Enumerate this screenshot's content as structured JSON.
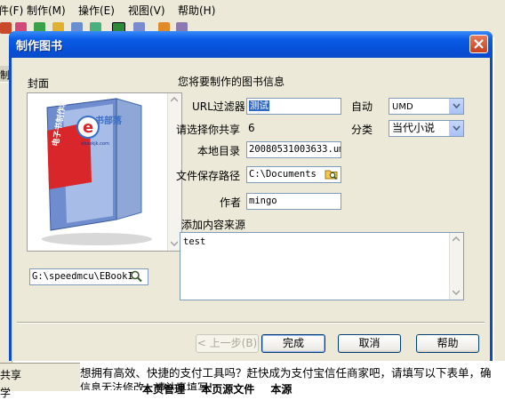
{
  "app": {
    "menu": [
      "件(F)",
      "制作(M)",
      "操作(E)",
      "视图(V)",
      "帮助(H)"
    ],
    "left_panel": {
      "label_top": "制",
      "label_share": "共享",
      "label_bottom": "学"
    },
    "notice_line1": "想拥有高效、快捷的支付工具吗？赶快成为支付宝信任商家吧，请填写以下表单，确",
    "notice_line2": "信息无法修改，请认真填写！",
    "bottom_tabs": [
      "本页管理",
      "本页源文件",
      "本源"
    ]
  },
  "dialog": {
    "title": "制作图书",
    "cover_label": "封面",
    "section_title": "您将要制作的图书信息",
    "cover_path": "G:\\speedmcu\\EBookI",
    "fields": {
      "url_filter_label": "URL过滤器",
      "url_filter_value": "测试",
      "auto_label": "自动",
      "auto_value": "UMD",
      "share_label": "请选择你共享",
      "share_value": "6",
      "category_label": "分类",
      "category_value": "当代小说",
      "local_dir_label": "本地目录",
      "local_dir_value": "20080531003633.um",
      "save_path_label": "文件保存路径",
      "save_path_value": "C:\\Documents",
      "author_label": "作者",
      "author_value": "mingo",
      "content_source_label": "添加内容来源",
      "content_source_value": "test"
    },
    "buttons": {
      "back": "< 上一步(B)",
      "finish": "完成",
      "cancel": "取消",
      "help": "帮助"
    },
    "book_cover": {
      "brand_letter": "e",
      "brand_name": "书部落",
      "brand_url": "ebookjk.com",
      "spine_text": "电子书制作利器",
      "accent_red": "#d8262a",
      "accent_blue": "#3a6fc8"
    }
  }
}
